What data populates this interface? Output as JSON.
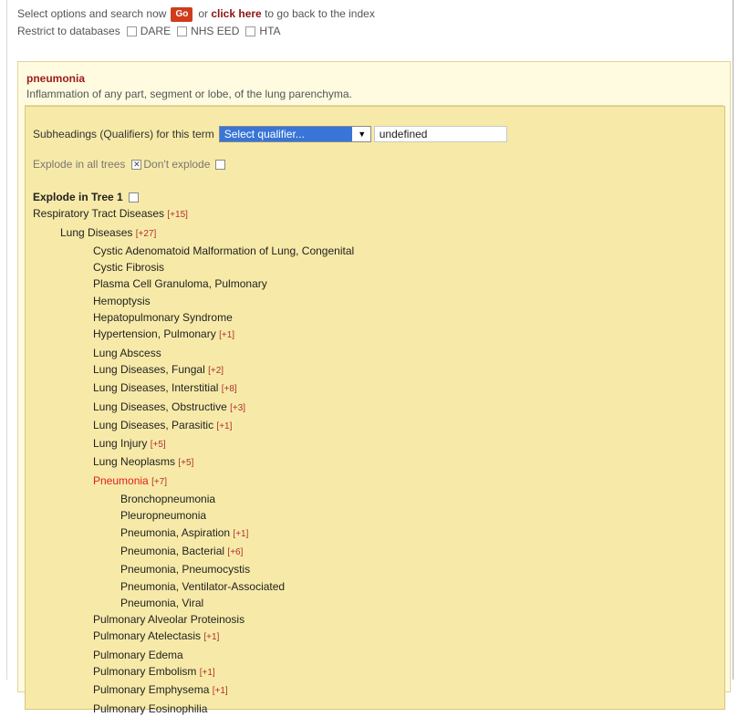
{
  "header": {
    "intro_text": "Select options and search now",
    "go_label": "Go",
    "or_text": "or",
    "click_here_label": "click here",
    "back_text": "to go back to the index",
    "restrict_text": "Restrict to databases",
    "databases": [
      "DARE",
      "NHS EED",
      "HTA"
    ]
  },
  "term": {
    "title": "pneumonia",
    "description": "Inflammation of any part, segment or lobe, of the lung parenchyma."
  },
  "qualifier": {
    "label": "Subheadings (Qualifiers) for this term",
    "selected": "Select qualifier...",
    "value": "undefined"
  },
  "explode": {
    "all_trees_label": "Explode in all trees",
    "dont_explode_label": "Don't explode",
    "dont_explode_checked": true,
    "tree_label": "Explode in Tree 1"
  },
  "tree": [
    {
      "label": "Respiratory Tract Diseases",
      "count": "[+15]",
      "level": 0
    },
    {
      "label": "Lung Diseases",
      "count": "[+27]",
      "level": 1
    },
    {
      "label": "Cystic Adenomatoid Malformation of Lung, Congenital",
      "count": "",
      "level": 2
    },
    {
      "label": "Cystic Fibrosis",
      "count": "",
      "level": 2
    },
    {
      "label": "Plasma Cell Granuloma, Pulmonary",
      "count": "",
      "level": 2
    },
    {
      "label": "Hemoptysis",
      "count": "",
      "level": 2
    },
    {
      "label": "Hepatopulmonary Syndrome",
      "count": "",
      "level": 2
    },
    {
      "label": "Hypertension, Pulmonary",
      "count": "[+1]",
      "level": 2
    },
    {
      "label": "Lung Abscess",
      "count": "",
      "level": 2
    },
    {
      "label": "Lung Diseases, Fungal",
      "count": "[+2]",
      "level": 2
    },
    {
      "label": "Lung Diseases, Interstitial",
      "count": "[+8]",
      "level": 2
    },
    {
      "label": "Lung Diseases, Obstructive",
      "count": "[+3]",
      "level": 2
    },
    {
      "label": "Lung Diseases, Parasitic",
      "count": "[+1]",
      "level": 2
    },
    {
      "label": "Lung Injury",
      "count": "[+5]",
      "level": 2
    },
    {
      "label": "Lung Neoplasms",
      "count": "[+5]",
      "level": 2
    },
    {
      "label": "Pneumonia",
      "count": "[+7]",
      "level": 2,
      "highlight": true
    },
    {
      "label": "Bronchopneumonia",
      "count": "",
      "level": 3
    },
    {
      "label": "Pleuropneumonia",
      "count": "",
      "level": 3
    },
    {
      "label": "Pneumonia, Aspiration",
      "count": "[+1]",
      "level": 3
    },
    {
      "label": "Pneumonia, Bacterial",
      "count": "[+6]",
      "level": 3
    },
    {
      "label": "Pneumonia, Pneumocystis",
      "count": "",
      "level": 3
    },
    {
      "label": "Pneumonia, Ventilator-Associated",
      "count": "",
      "level": 3
    },
    {
      "label": "Pneumonia, Viral",
      "count": "",
      "level": 3
    },
    {
      "label": "Pulmonary Alveolar Proteinosis",
      "count": "",
      "level": 2
    },
    {
      "label": "Pulmonary Atelectasis",
      "count": "[+1]",
      "level": 2
    },
    {
      "label": "Pulmonary Edema",
      "count": "",
      "level": 2
    },
    {
      "label": "Pulmonary Embolism",
      "count": "[+1]",
      "level": 2
    },
    {
      "label": "Pulmonary Emphysema",
      "count": "[+1]",
      "level": 2
    },
    {
      "label": "Pulmonary Eosinophilia",
      "count": "",
      "level": 2
    }
  ],
  "colors": {
    "accent_red": "#9b1b1b",
    "go_button": "#cf3c1c",
    "panel_bg": "#fffbe0",
    "inner_panel_bg": "#f7eaa8",
    "select_highlight": "#3875d7",
    "highlight_term": "#dd2222"
  }
}
